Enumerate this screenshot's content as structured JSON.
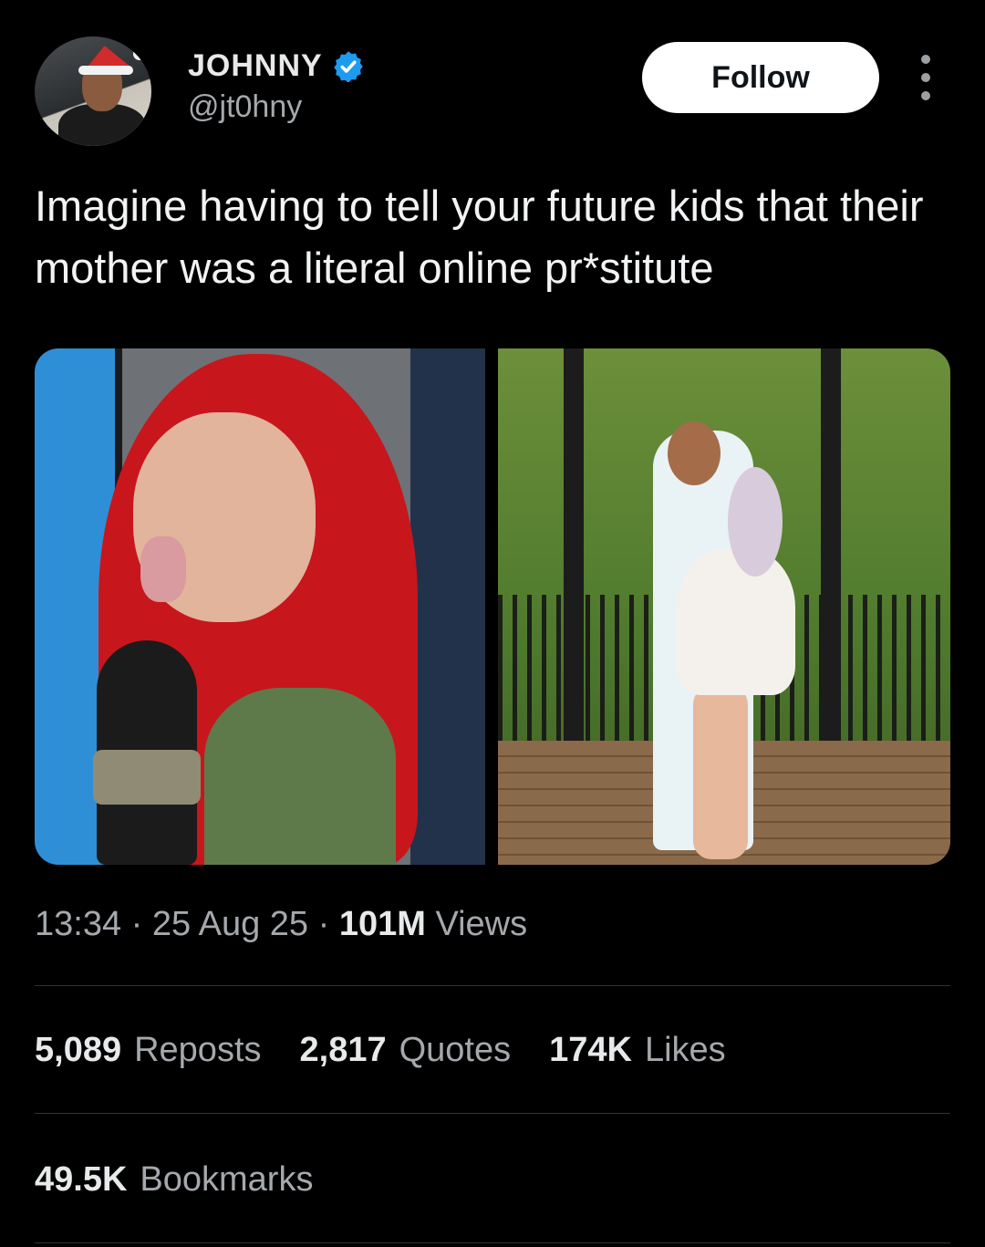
{
  "author": {
    "display_name": "JOHNNY",
    "handle": "@jt0hny",
    "verified_icon": "verified-badge-icon",
    "verified_color": "#1d9bf0"
  },
  "follow_label": "Follow",
  "tweet": {
    "text": "Imagine having to tell your future kids that their mother was a literal online pr*stitute"
  },
  "media": [
    {
      "icon": "photo-red-hair-woman-microphone"
    },
    {
      "icon": "photo-couple-kissing-deck"
    }
  ],
  "meta": {
    "time": "13:34",
    "sep1": " · ",
    "date": "25 Aug 25",
    "sep2": " · ",
    "views_count": "101M",
    "views_label": " Views"
  },
  "stats": {
    "reposts_count": "5,089",
    "reposts_label": "Reposts",
    "quotes_count": "2,817",
    "quotes_label": "Quotes",
    "likes_count": "174K",
    "likes_label": "Likes",
    "bookmarks_count": "49.5K",
    "bookmarks_label": "Bookmarks"
  },
  "colors": {
    "background": "#000000",
    "text_primary": "#e7e9ea",
    "text_secondary": "#a5a9ad",
    "divider": "#2f3336"
  }
}
